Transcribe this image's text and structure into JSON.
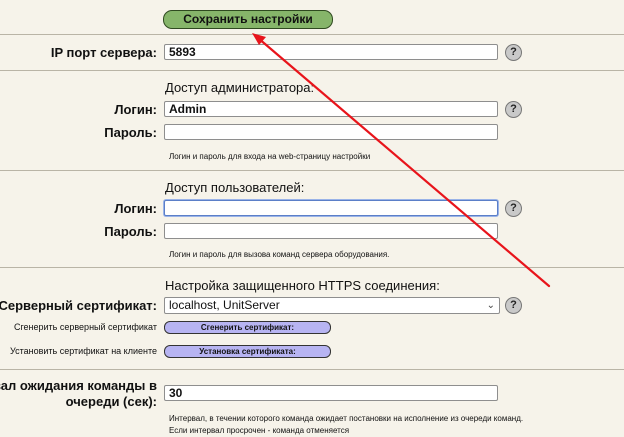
{
  "save_button": "Сохранить настройки",
  "help_glyph": "?",
  "port": {
    "label": "IP порт сервера:",
    "value": "5893"
  },
  "admin": {
    "heading": "Доступ администратора:",
    "login_label": "Логин:",
    "login_value": "Admin",
    "password_label": "Пароль:",
    "note": "Логин и пароль для входа на web-страницу настройки"
  },
  "users": {
    "heading": "Доступ пользователей:",
    "login_label": "Логин:",
    "password_label": "Пароль:",
    "note": "Логин и пароль для вызова команд сервера оборудования."
  },
  "https": {
    "heading": "Настройка защищенного HTTPS соединения:",
    "cert_label": "Серверный сертификат:",
    "cert_value": "localhost, UnitServer",
    "generate_label": "Сгенерить серверный сертификат",
    "generate_button": "Сгенерить сертификат:",
    "install_label": "Установить сертификат на клиенте",
    "install_button": "Установка сертификата:"
  },
  "queue": {
    "label_line1": "вал ожидания команды в",
    "label_line2": "очереди (сек):",
    "value": "30",
    "note_line1": "Интервал, в течении которого команда ожидает постановки на исполнение из очереди команд.",
    "note_line2": "Если интервал просрочен - команда отменяется"
  },
  "colors": {
    "save_button": "#86b56a",
    "purple_button": "#b7b4f2",
    "annotation_arrow": "#e8141b",
    "background": "#f6f3ea"
  }
}
